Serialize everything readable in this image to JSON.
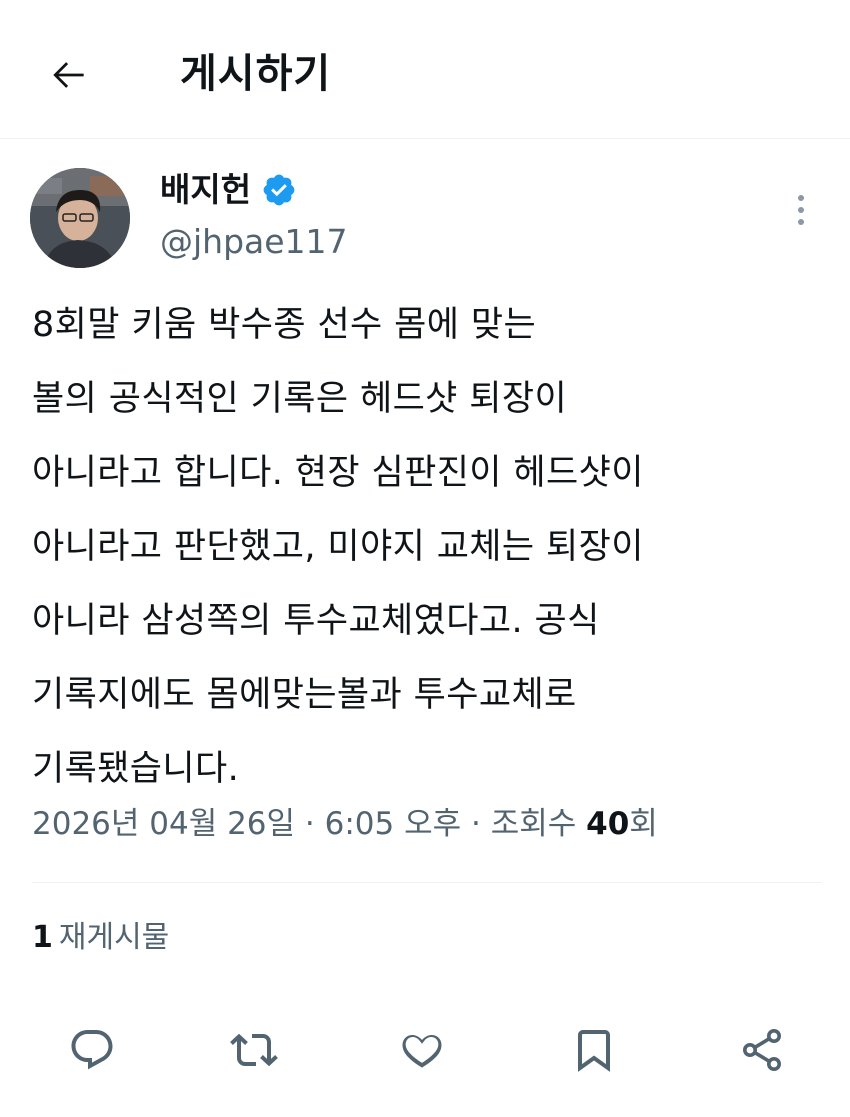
{
  "header": {
    "title": "게시하기",
    "back_icon": "arrow-left-icon"
  },
  "author": {
    "name": "배지헌",
    "handle": "@jhpae117",
    "verified": true,
    "verified_color": "#1d9bf0"
  },
  "tweet": {
    "lines": [
      "8회말 키움 박수종 선수 몸에 맞는",
      "볼의 공식적인 기록은 헤드샷 퇴장이",
      "아니라고 합니다. 현장 심판진이 헤드샷이",
      "아니라고 판단했고, 미야지 교체는 퇴장이",
      "아니라 삼성쪽의 투수교체였다고. 공식",
      "기록지에도 몸에맞는볼과 투수교체로",
      "기록됐습니다."
    ]
  },
  "meta": {
    "date": "2026년 04월 26일",
    "separator": " · ",
    "time": "6:05 오후",
    "views_label": "조회수",
    "views_count": "40",
    "views_unit": "회"
  },
  "reposts": {
    "count": "1",
    "label": "재게시물"
  },
  "actions": {
    "reply_icon": "reply-icon",
    "retweet_icon": "retweet-icon",
    "like_icon": "heart-icon",
    "bookmark_icon": "bookmark-icon",
    "share_icon": "share-icon",
    "icon_color": "#536471"
  },
  "colors": {
    "text": "#0f1419",
    "secondary": "#536471",
    "divider": "#eff3f4"
  }
}
